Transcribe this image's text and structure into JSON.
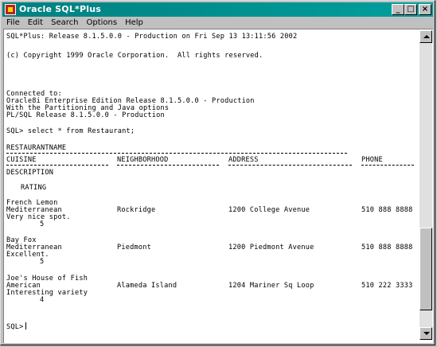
{
  "window": {
    "title": "Oracle SQL*Plus",
    "buttons": {
      "minimize": "_",
      "maximize": "□",
      "close": "×"
    }
  },
  "menu": [
    "File",
    "Edit",
    "Search",
    "Options",
    "Help"
  ],
  "console": {
    "banner": "SQL*Plus: Release 8.1.5.0.0 - Production on Fri Sep 13 13:11:56 2002",
    "copyright": "(c) Copyright 1999 Oracle Corporation.  All rights reserved.",
    "connected": "Connected to:",
    "edition": "Oracle8i Enterprise Edition Release 8.1.5.0.0 - Production",
    "options": "With the Partitioning and Java options",
    "plsql": "PL/SQL Release 8.1.5.0.0 - Production",
    "command": "SQL> select * from Restaurant;",
    "header_name": "RESTAURANTNAME",
    "headers": {
      "cuisine": "CUISINE",
      "neighborhood": "NEIGHBORHOOD",
      "address": "ADDRESS",
      "phone": "PHONE",
      "description": "DESCRIPTION",
      "rating": "RATING"
    },
    "rows": [
      {
        "name": "French Lemon",
        "cuisine": "Mediterranean",
        "neighborhood": "Rockridge",
        "address": "1200 College Avenue",
        "phone": "510 888 8888",
        "description": "Very nice spot.",
        "rating": "5"
      },
      {
        "name": "Bay Fox",
        "cuisine": "Mediterranean",
        "neighborhood": "Piedmont",
        "address": "1200 Piedmont Avenue",
        "phone": "510 888 8888",
        "description": "Excellent.",
        "rating": "5"
      },
      {
        "name": "Joe's House of Fish",
        "cuisine": "American",
        "neighborhood": "Alameda Island",
        "address": "1204 Mariner Sq Loop",
        "phone": "510 222 3333",
        "description": "Interesting variety",
        "rating": "4"
      }
    ],
    "prompt": "SQL>"
  }
}
